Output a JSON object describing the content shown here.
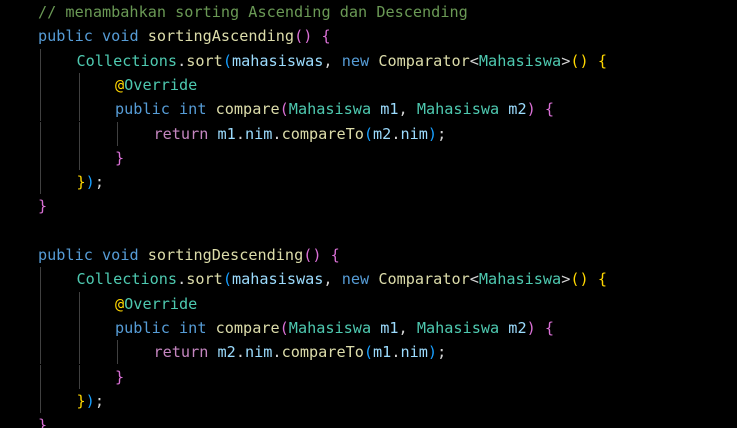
{
  "colors": {
    "background": "#000000",
    "comment": "#6a9955",
    "keyword": "#569cd6",
    "control": "#c586c0",
    "function": "#dcdcaa",
    "type": "#4ec9b0",
    "variable": "#9cdcfe",
    "plain": "#d4d4d4",
    "bracket1": "#ffd700",
    "bracket2": "#da70d6",
    "bracket3": "#179fff",
    "guide": "#404040"
  },
  "code": {
    "lines": [
      {
        "indent": 0,
        "tokens": [
          {
            "t": "// menambahkan sorting Ascending dan Descending",
            "c": "comment"
          }
        ]
      },
      {
        "indent": 0,
        "tokens": [
          {
            "t": "public",
            "c": "keyword"
          },
          {
            "t": " ",
            "c": "plain"
          },
          {
            "t": "void",
            "c": "keyword"
          },
          {
            "t": " ",
            "c": "plain"
          },
          {
            "t": "sortingAscending",
            "c": "function"
          },
          {
            "t": "()",
            "c": "bracket2"
          },
          {
            "t": " ",
            "c": "plain"
          },
          {
            "t": "{",
            "c": "bracket2"
          }
        ]
      },
      {
        "indent": 1,
        "tokens": [
          {
            "t": "Collections",
            "c": "type"
          },
          {
            "t": ".",
            "c": "plain"
          },
          {
            "t": "sort",
            "c": "function"
          },
          {
            "t": "(",
            "c": "bracket3"
          },
          {
            "t": "mahasiswas",
            "c": "variable"
          },
          {
            "t": ", ",
            "c": "plain"
          },
          {
            "t": "new",
            "c": "keyword"
          },
          {
            "t": " ",
            "c": "plain"
          },
          {
            "t": "Comparator",
            "c": "function"
          },
          {
            "t": "<",
            "c": "plain"
          },
          {
            "t": "Mahasiswa",
            "c": "type"
          },
          {
            "t": ">",
            "c": "plain"
          },
          {
            "t": "()",
            "c": "bracket1"
          },
          {
            "t": " ",
            "c": "plain"
          },
          {
            "t": "{",
            "c": "bracket1"
          }
        ]
      },
      {
        "indent": 2,
        "tokens": [
          {
            "t": "@",
            "c": "bracket1"
          },
          {
            "t": "Override",
            "c": "type"
          }
        ]
      },
      {
        "indent": 2,
        "tokens": [
          {
            "t": "public",
            "c": "keyword"
          },
          {
            "t": " ",
            "c": "plain"
          },
          {
            "t": "int",
            "c": "keyword"
          },
          {
            "t": " ",
            "c": "plain"
          },
          {
            "t": "compare",
            "c": "function"
          },
          {
            "t": "(",
            "c": "bracket2"
          },
          {
            "t": "Mahasiswa",
            "c": "type"
          },
          {
            "t": " ",
            "c": "plain"
          },
          {
            "t": "m1",
            "c": "variable"
          },
          {
            "t": ", ",
            "c": "plain"
          },
          {
            "t": "Mahasiswa",
            "c": "type"
          },
          {
            "t": " ",
            "c": "plain"
          },
          {
            "t": "m2",
            "c": "variable"
          },
          {
            "t": ")",
            "c": "bracket2"
          },
          {
            "t": " ",
            "c": "plain"
          },
          {
            "t": "{",
            "c": "bracket2"
          }
        ]
      },
      {
        "indent": 3,
        "tokens": [
          {
            "t": "return",
            "c": "control"
          },
          {
            "t": " ",
            "c": "plain"
          },
          {
            "t": "m1",
            "c": "variable"
          },
          {
            "t": ".",
            "c": "plain"
          },
          {
            "t": "nim",
            "c": "variable"
          },
          {
            "t": ".",
            "c": "plain"
          },
          {
            "t": "compareTo",
            "c": "function"
          },
          {
            "t": "(",
            "c": "bracket3"
          },
          {
            "t": "m2",
            "c": "variable"
          },
          {
            "t": ".",
            "c": "plain"
          },
          {
            "t": "nim",
            "c": "variable"
          },
          {
            "t": ")",
            "c": "bracket3"
          },
          {
            "t": ";",
            "c": "plain"
          }
        ]
      },
      {
        "indent": 2,
        "tokens": [
          {
            "t": "}",
            "c": "bracket2"
          }
        ]
      },
      {
        "indent": 1,
        "tokens": [
          {
            "t": "}",
            "c": "bracket1"
          },
          {
            "t": ")",
            "c": "bracket3"
          },
          {
            "t": ";",
            "c": "plain"
          }
        ]
      },
      {
        "indent": 0,
        "tokens": [
          {
            "t": "}",
            "c": "bracket2"
          }
        ]
      },
      {
        "indent": 0,
        "tokens": []
      },
      {
        "indent": 0,
        "tokens": [
          {
            "t": "public",
            "c": "keyword"
          },
          {
            "t": " ",
            "c": "plain"
          },
          {
            "t": "void",
            "c": "keyword"
          },
          {
            "t": " ",
            "c": "plain"
          },
          {
            "t": "sortingDescending",
            "c": "function"
          },
          {
            "t": "()",
            "c": "bracket2"
          },
          {
            "t": " ",
            "c": "plain"
          },
          {
            "t": "{",
            "c": "bracket2"
          }
        ]
      },
      {
        "indent": 1,
        "tokens": [
          {
            "t": "Collections",
            "c": "type"
          },
          {
            "t": ".",
            "c": "plain"
          },
          {
            "t": "sort",
            "c": "function"
          },
          {
            "t": "(",
            "c": "bracket3"
          },
          {
            "t": "mahasiswas",
            "c": "variable"
          },
          {
            "t": ", ",
            "c": "plain"
          },
          {
            "t": "new",
            "c": "keyword"
          },
          {
            "t": " ",
            "c": "plain"
          },
          {
            "t": "Comparator",
            "c": "function"
          },
          {
            "t": "<",
            "c": "plain"
          },
          {
            "t": "Mahasiswa",
            "c": "type"
          },
          {
            "t": ">",
            "c": "plain"
          },
          {
            "t": "()",
            "c": "bracket1"
          },
          {
            "t": " ",
            "c": "plain"
          },
          {
            "t": "{",
            "c": "bracket1"
          }
        ]
      },
      {
        "indent": 2,
        "tokens": [
          {
            "t": "@",
            "c": "bracket1"
          },
          {
            "t": "Override",
            "c": "type"
          }
        ]
      },
      {
        "indent": 2,
        "tokens": [
          {
            "t": "public",
            "c": "keyword"
          },
          {
            "t": " ",
            "c": "plain"
          },
          {
            "t": "int",
            "c": "keyword"
          },
          {
            "t": " ",
            "c": "plain"
          },
          {
            "t": "compare",
            "c": "function"
          },
          {
            "t": "(",
            "c": "bracket2"
          },
          {
            "t": "Mahasiswa",
            "c": "type"
          },
          {
            "t": " ",
            "c": "plain"
          },
          {
            "t": "m1",
            "c": "variable"
          },
          {
            "t": ", ",
            "c": "plain"
          },
          {
            "t": "Mahasiswa",
            "c": "type"
          },
          {
            "t": " ",
            "c": "plain"
          },
          {
            "t": "m2",
            "c": "variable"
          },
          {
            "t": ")",
            "c": "bracket2"
          },
          {
            "t": " ",
            "c": "plain"
          },
          {
            "t": "{",
            "c": "bracket2"
          }
        ]
      },
      {
        "indent": 3,
        "tokens": [
          {
            "t": "return",
            "c": "control"
          },
          {
            "t": " ",
            "c": "plain"
          },
          {
            "t": "m2",
            "c": "variable"
          },
          {
            "t": ".",
            "c": "plain"
          },
          {
            "t": "nim",
            "c": "variable"
          },
          {
            "t": ".",
            "c": "plain"
          },
          {
            "t": "compareTo",
            "c": "function"
          },
          {
            "t": "(",
            "c": "bracket3"
          },
          {
            "t": "m1",
            "c": "variable"
          },
          {
            "t": ".",
            "c": "plain"
          },
          {
            "t": "nim",
            "c": "variable"
          },
          {
            "t": ")",
            "c": "bracket3"
          },
          {
            "t": ";",
            "c": "plain"
          }
        ]
      },
      {
        "indent": 2,
        "tokens": [
          {
            "t": "}",
            "c": "bracket2"
          }
        ]
      },
      {
        "indent": 1,
        "tokens": [
          {
            "t": "}",
            "c": "bracket1"
          },
          {
            "t": ")",
            "c": "bracket3"
          },
          {
            "t": ";",
            "c": "plain"
          }
        ]
      },
      {
        "indent": 0,
        "tokens": [
          {
            "t": "}",
            "c": "bracket2"
          }
        ]
      }
    ]
  }
}
